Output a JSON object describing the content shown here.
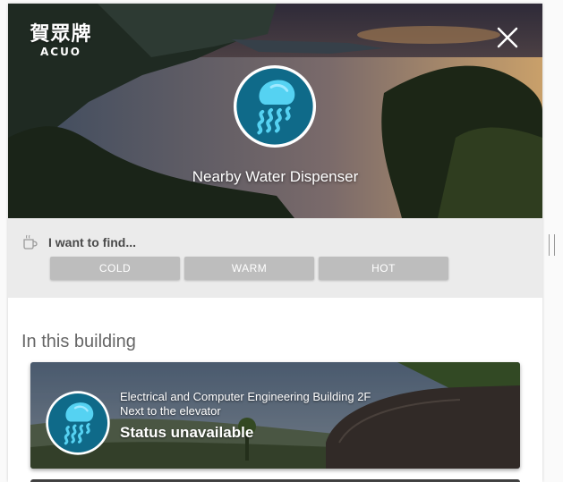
{
  "header": {
    "logo_cn": "賀眾牌",
    "logo_en": "ACUO",
    "title": "Nearby Water Dispenser"
  },
  "finder": {
    "label": "I want to find...",
    "buttons": [
      "COLD",
      "WARM",
      "HOT"
    ]
  },
  "building": {
    "heading": "In this building",
    "dispensers": [
      {
        "location_line1": "Electrical and Computer Engineering Building 2F",
        "location_line2": "Next to the elevator",
        "status": "Status unavailable"
      }
    ]
  },
  "icons": {
    "close": "close-icon",
    "cup": "cup-icon",
    "emblem": "jellyfish-icon"
  },
  "colors": {
    "emblem_bg": "#0f6a89",
    "emblem_fg": "#55d2f2",
    "button_bg": "#bdbdbd",
    "finder_bg": "#ebebeb"
  }
}
